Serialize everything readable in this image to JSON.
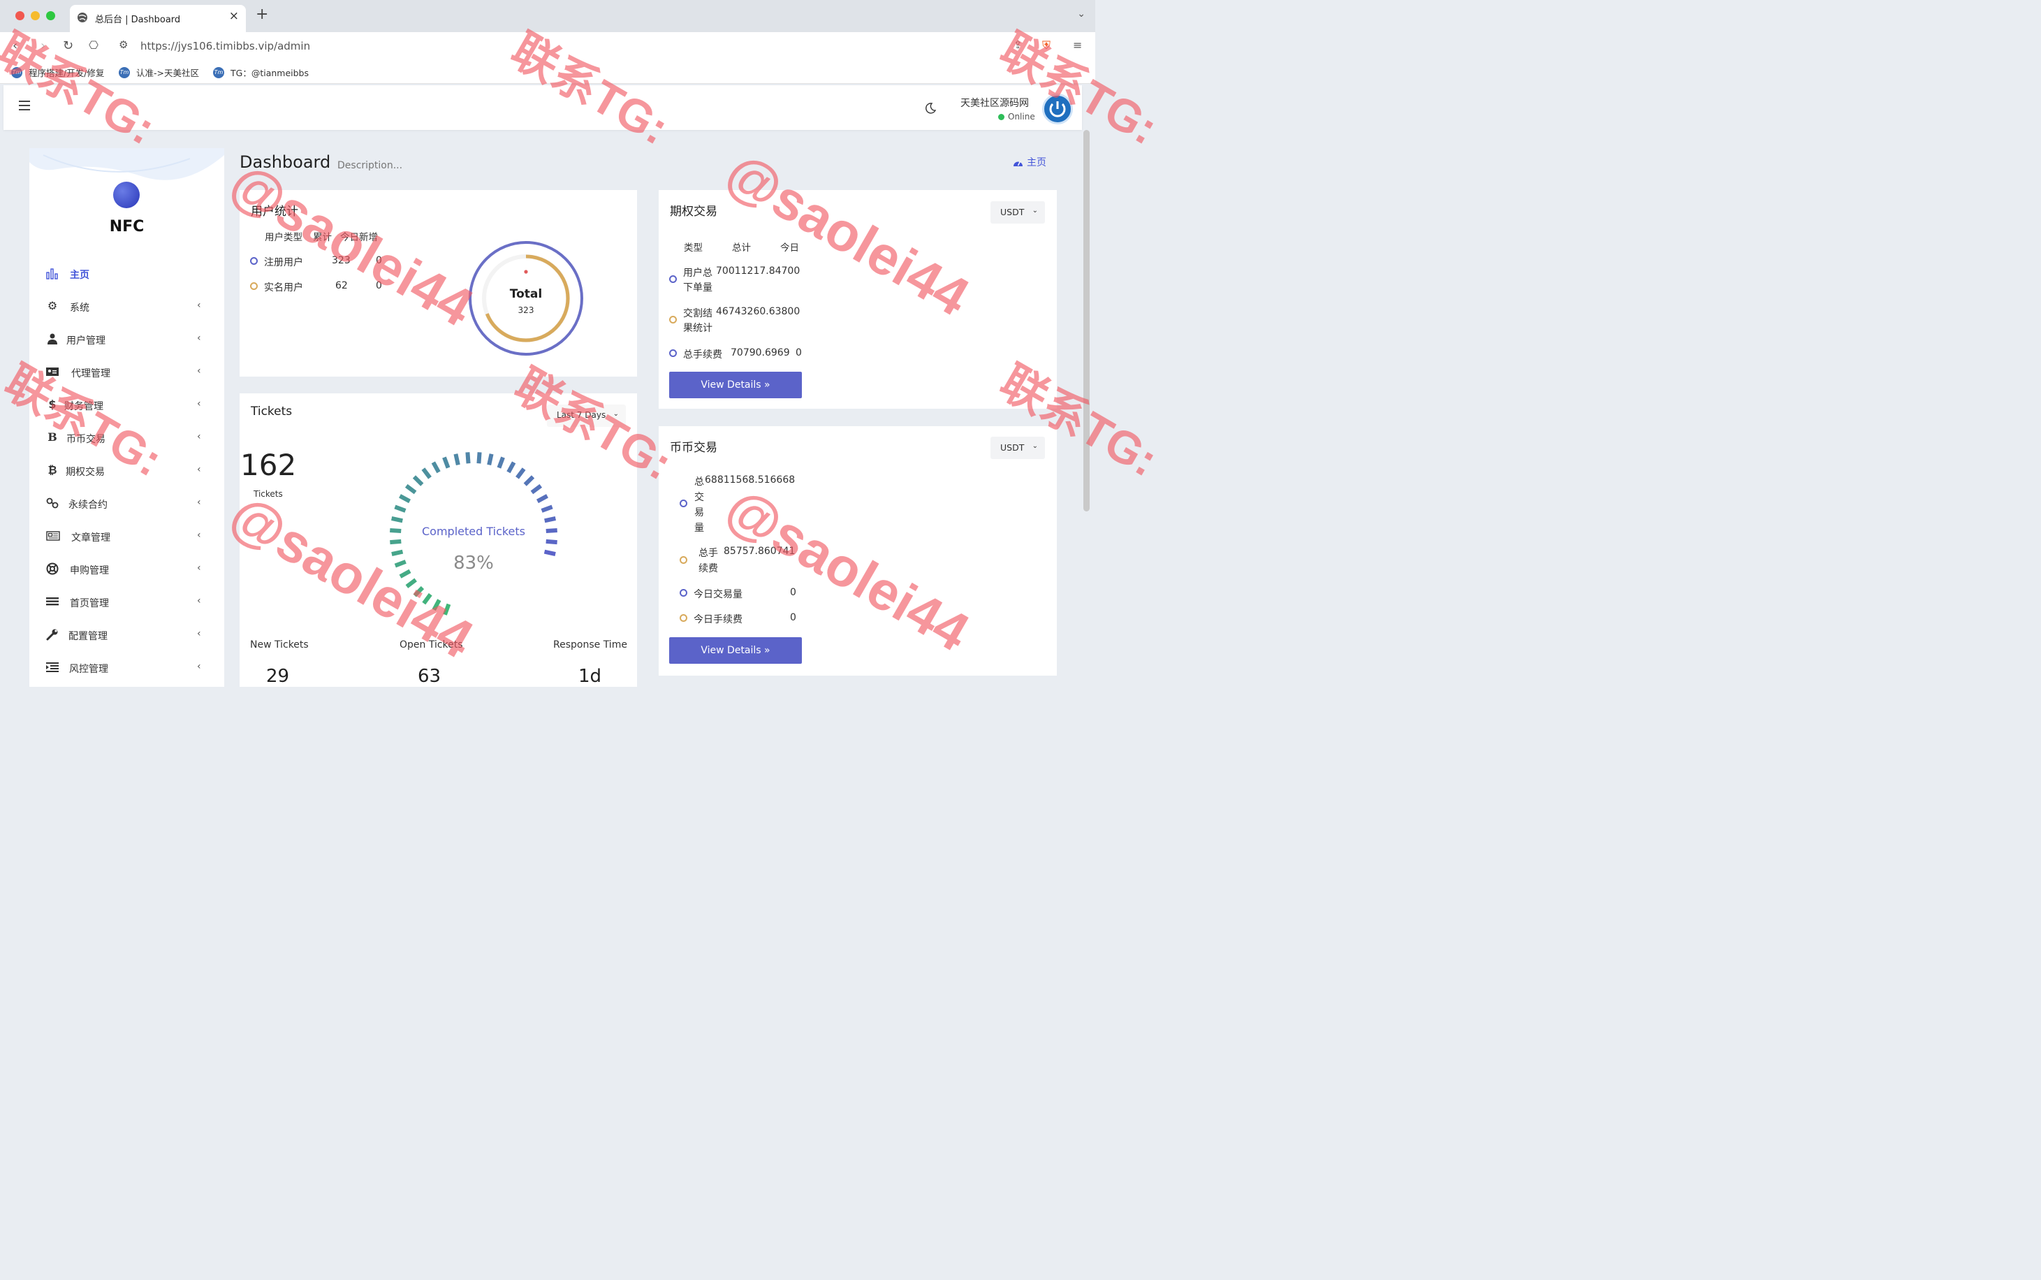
{
  "browser": {
    "tab_title": "总后台 | Dashboard",
    "url": "https://jys106.timibbs.vip/admin",
    "bookmarks": [
      "程序搭建/开发/修复",
      "认准->天美社区",
      "TG：@tianmeibbs"
    ],
    "colors": {
      "close": "#f1584f",
      "minimize": "#f6bb2e",
      "maximize": "#2ec840"
    }
  },
  "header": {
    "user_name": "天美社区源码网",
    "status": "Online"
  },
  "sidebar": {
    "brand": "NFC",
    "items": [
      {
        "label": "主页",
        "icon": "bar-chart-icon",
        "active": true
      },
      {
        "label": "系统",
        "icon": "gear-icon"
      },
      {
        "label": "用户管理",
        "icon": "user-icon"
      },
      {
        "label": "代理管理",
        "icon": "id-card-icon"
      },
      {
        "label": "财务管理",
        "icon": "dollar-icon"
      },
      {
        "label": "币币交易",
        "icon": "b-letter-icon"
      },
      {
        "label": "期权交易",
        "icon": "bitcoin-icon"
      },
      {
        "label": "永续合约",
        "icon": "link-icon"
      },
      {
        "label": "文章管理",
        "icon": "newspaper-icon"
      },
      {
        "label": "申购管理",
        "icon": "lifebuoy-icon"
      },
      {
        "label": "首页管理",
        "icon": "list-icon"
      },
      {
        "label": "配置管理",
        "icon": "wrench-icon"
      },
      {
        "label": "风控管理",
        "icon": "indent-list-icon"
      }
    ]
  },
  "page": {
    "title": "Dashboard",
    "description": "Description...",
    "breadcrumb": "主页"
  },
  "user_stats": {
    "title": "用户统计",
    "headers": [
      "用户类型",
      "累计",
      "今日新增"
    ],
    "rows": [
      {
        "type": "注册用户",
        "total": "323",
        "today": "0",
        "color": "#5b63c9"
      },
      {
        "type": "实名用户",
        "total": "62",
        "today": "0",
        "color": "#d8aa5c"
      }
    ],
    "donut": {
      "label": "Total",
      "value": "323"
    }
  },
  "tickets": {
    "title": "Tickets",
    "range": "Last 7 Days",
    "count": "162",
    "count_label": "Tickets",
    "gauge_label": "Completed Tickets",
    "percent": 83,
    "percent_label": "83%",
    "stats": [
      {
        "label": "New Tickets",
        "value": "29"
      },
      {
        "label": "Open Tickets",
        "value": "63"
      },
      {
        "label": "Response Time",
        "value": "1d"
      }
    ]
  },
  "options_trading": {
    "title": "期权交易",
    "currency": "USDT",
    "headers": [
      "类型",
      "总计",
      "今日"
    ],
    "rows": [
      {
        "type_l1": "用户总",
        "type_l2": "下单量",
        "total": "70011217.84700",
        "today": "",
        "color": "#5b63c9"
      },
      {
        "type_l1": "交割结",
        "type_l2": "果统计",
        "total": "46743260.63800",
        "today": "",
        "color": "#d8aa5c"
      },
      {
        "type_l1": "总手续费",
        "type_l2": "",
        "total": "70790.6969",
        "today": "0",
        "color": "#5b63c9"
      }
    ],
    "button": "View Details"
  },
  "coin_trading": {
    "title": "币币交易",
    "currency": "USDT",
    "rows": [
      {
        "label_chars": [
          "总",
          "交",
          "易",
          "量"
        ],
        "total": "68811568.516668",
        "today": "",
        "color": "#5b63c9"
      },
      {
        "label_l1": "总手",
        "label_l2": "续费",
        "total": "85757.860741",
        "today": "",
        "color": "#d8aa5c"
      },
      {
        "label_l1": "今日交易量",
        "total": "",
        "today": "0",
        "color": "#5b63c9"
      },
      {
        "label_l1": "今日手续费",
        "total": "",
        "today": "0",
        "color": "#d8aa5c"
      }
    ],
    "button": "View Details"
  },
  "watermark": {
    "lines": [
      "联系TG:",
      "@saolei44"
    ]
  }
}
